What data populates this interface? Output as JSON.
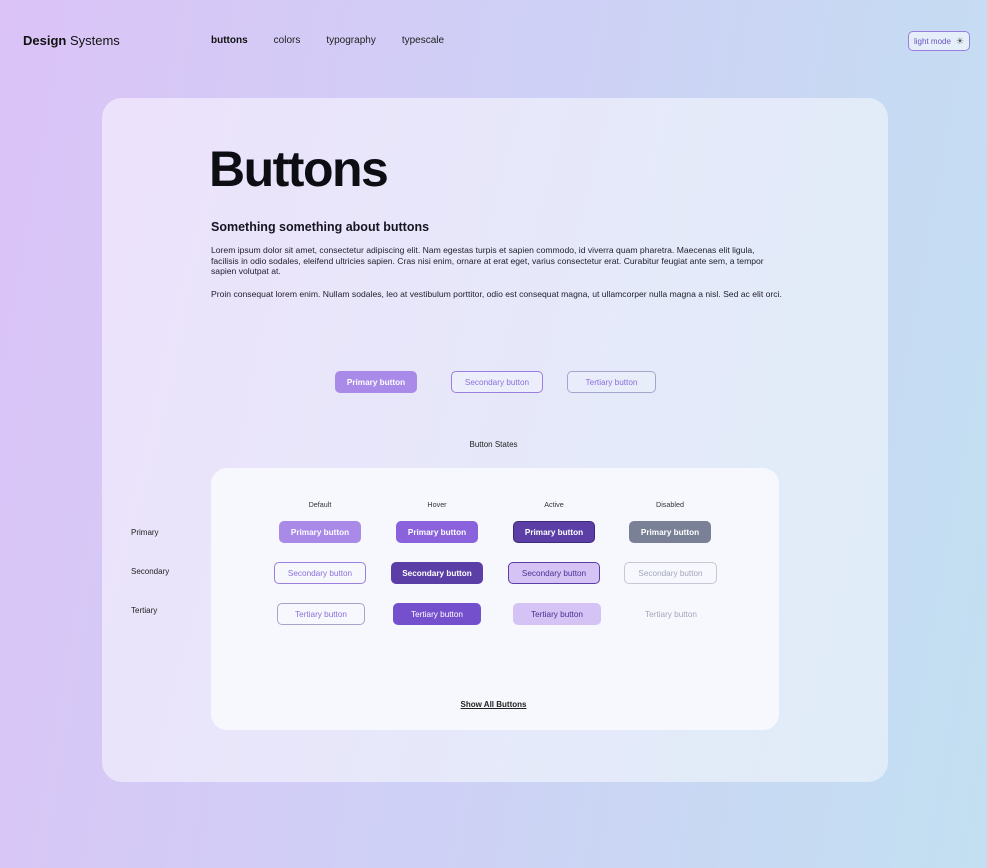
{
  "header": {
    "brand_bold": "Design",
    "brand_rest": "Systems",
    "nav": [
      {
        "label": "buttons"
      },
      {
        "label": "colors"
      },
      {
        "label": "typography"
      },
      {
        "label": "typescale"
      }
    ],
    "mode_label": "light mode",
    "mode_icon": "sun-icon"
  },
  "main": {
    "title": "Buttons",
    "subtitle": "Something something about buttons",
    "paragraph1": "Lorem ipsum dolor sit amet, consectetur adipiscing elit. Nam egestas turpis et sapien commodo, id viverra quam pharetra. Maecenas elit ligula, facilisis in odio sodales, eleifend ultricies sapien. Cras nisi enim, ornare at erat eget, varius consectetur erat. Curabitur feugiat ante sem, a tempor sapien volutpat at.",
    "paragraph2": "Proin consequat lorem enim. Nullam sodales, leo at vestibulum porttitor, odio est consequat magna, ut ullamcorper nulla magna a nisl. Sed ac elit orci.",
    "demo": {
      "primary": "Primary button",
      "secondary": "Secondary button",
      "tertiary": "Tertiary button"
    },
    "states_title": "Button States",
    "columns": [
      "Default",
      "Hover",
      "Active",
      "Disabled"
    ],
    "rows": [
      {
        "label": "Primary",
        "button": "Primary button"
      },
      {
        "label": "Secondary",
        "button": "Secondary button"
      },
      {
        "label": "Tertiary",
        "button": "Tertiary button"
      }
    ],
    "show_all": "Show All Buttons"
  },
  "colors": {
    "primary": "#a98ae8",
    "primary_hover": "#8a62dc",
    "primary_active": "#5b3fa6",
    "disabled": "#7a8197"
  }
}
